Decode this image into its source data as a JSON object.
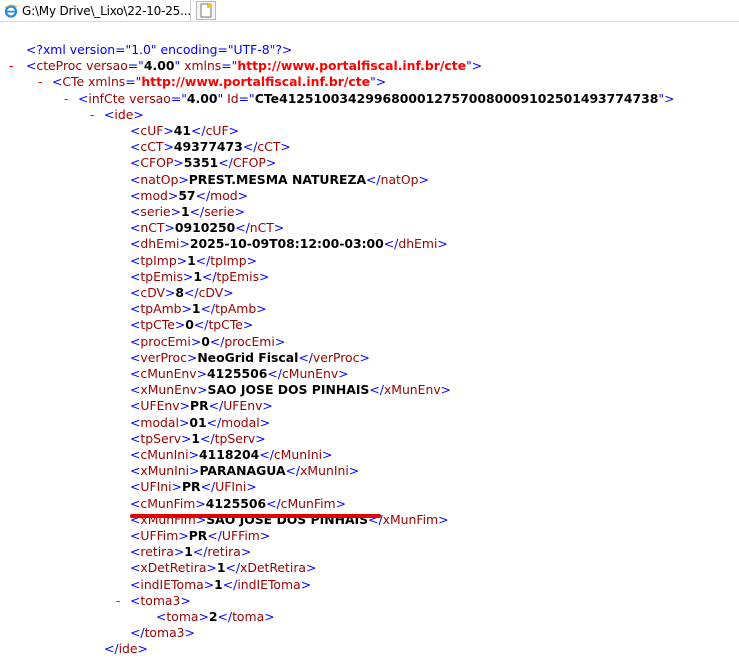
{
  "tab": {
    "title": "G:\\My Drive\\_Lixo\\22-10-25..."
  },
  "xml": {
    "declaration": "<?xml version=\"1.0\" encoding=\"UTF-8\"?>",
    "cteProc": {
      "tag": "cteProc",
      "versao_attr": "versao",
      "versao": "4.00",
      "xmlns_attr": "xmlns",
      "xmlns": "http://www.portalfiscal.inf.br/cte"
    },
    "CTe": {
      "tag": "CTe",
      "xmlns_attr": "xmlns",
      "xmlns": "http://www.portalfiscal.inf.br/cte"
    },
    "infCte": {
      "tag": "infCte",
      "versao_attr": "versao",
      "versao": "4.00",
      "id_attr": "Id",
      "id": "CTe41251003429968000127570080009102501493774738"
    },
    "ide_tag": "ide",
    "fields": [
      {
        "tag": "cUF",
        "value": "41"
      },
      {
        "tag": "cCT",
        "value": "49377473"
      },
      {
        "tag": "CFOP",
        "value": "5351"
      },
      {
        "tag": "natOp",
        "value": "PREST.MESMA NATUREZA"
      },
      {
        "tag": "mod",
        "value": "57"
      },
      {
        "tag": "serie",
        "value": "1"
      },
      {
        "tag": "nCT",
        "value": "0910250"
      },
      {
        "tag": "dhEmi",
        "value": "2025-10-09T08:12:00-03:00"
      },
      {
        "tag": "tpImp",
        "value": "1"
      },
      {
        "tag": "tpEmis",
        "value": "1"
      },
      {
        "tag": "cDV",
        "value": "8"
      },
      {
        "tag": "tpAmb",
        "value": "1"
      },
      {
        "tag": "tpCTe",
        "value": "0"
      },
      {
        "tag": "procEmi",
        "value": "0"
      },
      {
        "tag": "verProc",
        "value": "NeoGrid Fiscal"
      },
      {
        "tag": "cMunEnv",
        "value": "4125506"
      },
      {
        "tag": "xMunEnv",
        "value": "SAO JOSE DOS PINHAIS"
      },
      {
        "tag": "UFEnv",
        "value": "PR"
      },
      {
        "tag": "modal",
        "value": "01"
      },
      {
        "tag": "tpServ",
        "value": "1"
      },
      {
        "tag": "cMunIni",
        "value": "4118204"
      },
      {
        "tag": "xMunIni",
        "value": "PARANAGUA"
      },
      {
        "tag": "UFIni",
        "value": "PR"
      },
      {
        "tag": "cMunFim",
        "value": "4125506"
      },
      {
        "tag": "xMunFim",
        "value": "SAO JOSE DOS PINHAIS"
      },
      {
        "tag": "UFFim",
        "value": "PR"
      },
      {
        "tag": "retira",
        "value": "1"
      },
      {
        "tag": "xDetRetira",
        "value": "1"
      },
      {
        "tag": "indIEToma",
        "value": "1"
      }
    ],
    "toma3": {
      "tag": "toma3",
      "child_tag": "toma",
      "child_value": "2"
    },
    "collapse_symbol": "-"
  }
}
